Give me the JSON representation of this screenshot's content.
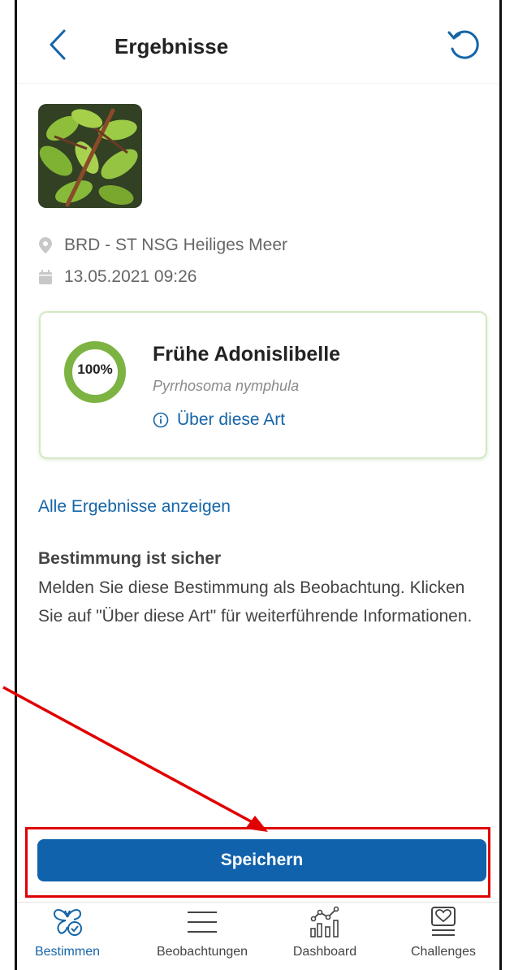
{
  "header": {
    "title": "Ergebnisse",
    "back_icon": "chevron-left-icon",
    "reset_icon": "undo-icon"
  },
  "observation": {
    "photo_alt": "dragonfly-photo",
    "location": "BRD - ST NSG Heiliges Meer",
    "datetime": "13.05.2021 09:26"
  },
  "result": {
    "confidence_label": "100%",
    "confidence_value": 1.0,
    "species_name": "Frühe Adonislibelle",
    "latin_name": "Pyrrhosoma nymphula",
    "about_link": "Über diese Art"
  },
  "all_results_link": "Alle Ergebnisse anzeigen",
  "info": {
    "title": "Bestimmung ist sicher",
    "text": "Melden Sie diese Bestimmung als Beobachtung. Klicken Sie auf \"Über diese Art\" für weiterführende Informationen."
  },
  "save_button": "Speichern",
  "nav": {
    "items": [
      {
        "label": "Bestimmen",
        "icon": "butterfly-check-icon",
        "active": true
      },
      {
        "label": "Beobachtungen",
        "icon": "list-icon",
        "active": false
      },
      {
        "label": "Dashboard",
        "icon": "chart-icon",
        "active": false
      },
      {
        "label": "Challenges",
        "icon": "heart-badge-icon",
        "active": false
      }
    ]
  },
  "colors": {
    "primary": "#1062ad",
    "link": "#1565a8",
    "confidence_ring": "#7cb342",
    "highlight": "#e00000"
  }
}
